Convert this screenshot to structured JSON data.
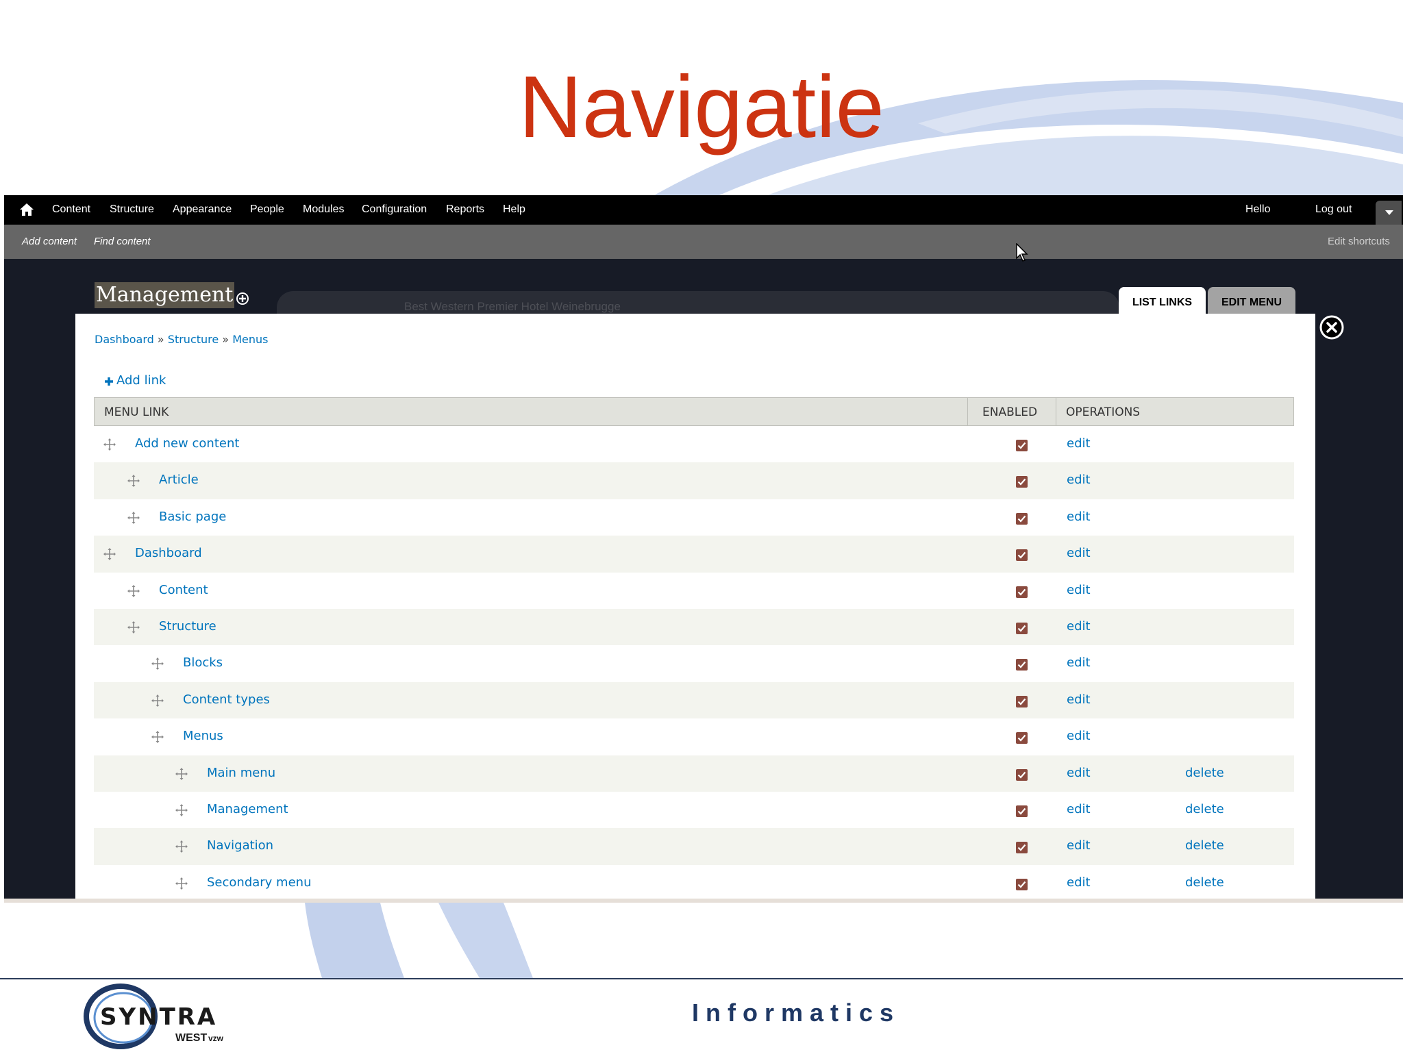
{
  "slide": {
    "title": "Navigatie",
    "footer": "Informatics",
    "logo": {
      "main": "SYNTRA",
      "sub": "WEST",
      "suffix": "vzw"
    },
    "colors": {
      "title": "#cc3311",
      "swirl": "#c5d3ee",
      "footer": "#1f3864"
    }
  },
  "toolbar": {
    "nav": [
      "Content",
      "Structure",
      "Appearance",
      "People",
      "Modules",
      "Configuration",
      "Reports",
      "Help"
    ],
    "hello": "Hello",
    "logout": "Log out"
  },
  "shortcuts": {
    "add_content": "Add content",
    "find_content": "Find content",
    "edit_shortcuts": "Edit shortcuts"
  },
  "overlay": {
    "title": "Management",
    "background_page_title": "Best Western Premier Hotel Weinebrugge",
    "tabs": {
      "list_links": "LIST LINKS",
      "edit_menu": "EDIT MENU"
    }
  },
  "breadcrumb": [
    "Dashboard",
    "Structure",
    "Menus"
  ],
  "breadcrumb_sep": "»",
  "add_link": "Add link",
  "table": {
    "headers": {
      "menu_link": "MENU LINK",
      "enabled": "ENABLED",
      "operations": "OPERATIONS"
    },
    "rows": [
      {
        "label": "Add new content",
        "depth": 0,
        "enabled": true,
        "edit": "edit"
      },
      {
        "label": "Article",
        "depth": 1,
        "enabled": true,
        "edit": "edit"
      },
      {
        "label": "Basic page",
        "depth": 1,
        "enabled": true,
        "edit": "edit"
      },
      {
        "label": "Dashboard",
        "depth": 0,
        "enabled": true,
        "edit": "edit"
      },
      {
        "label": "Content",
        "depth": 1,
        "enabled": true,
        "edit": "edit"
      },
      {
        "label": "Structure",
        "depth": 1,
        "enabled": true,
        "edit": "edit"
      },
      {
        "label": "Blocks",
        "depth": 2,
        "enabled": true,
        "edit": "edit"
      },
      {
        "label": "Content types",
        "depth": 2,
        "enabled": true,
        "edit": "edit"
      },
      {
        "label": "Menus",
        "depth": 2,
        "enabled": true,
        "edit": "edit"
      },
      {
        "label": "Main menu",
        "depth": 3,
        "enabled": true,
        "edit": "edit",
        "delete": "delete"
      },
      {
        "label": "Management",
        "depth": 3,
        "enabled": true,
        "edit": "edit",
        "delete": "delete"
      },
      {
        "label": "Navigation",
        "depth": 3,
        "enabled": true,
        "edit": "edit",
        "delete": "delete"
      },
      {
        "label": "Secondary menu",
        "depth": 3,
        "enabled": true,
        "edit": "edit",
        "delete": "delete"
      }
    ]
  }
}
